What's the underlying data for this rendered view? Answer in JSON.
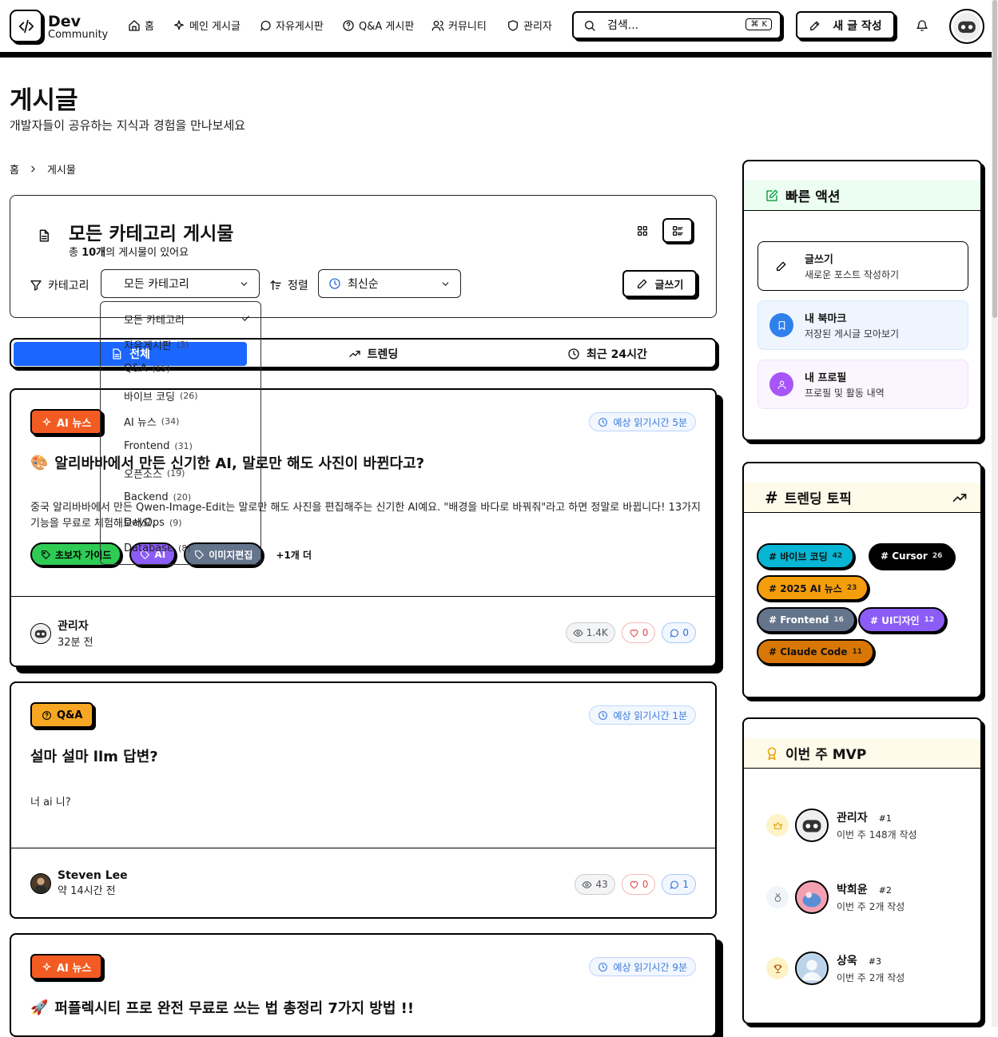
{
  "header": {
    "logo_title": "Dev",
    "logo_sub": "Community",
    "nav": [
      {
        "label": "홈",
        "icon": "home-icon"
      },
      {
        "label": "메인 게시글",
        "icon": "sparkles-icon"
      },
      {
        "label": "자유게시판",
        "icon": "chat-bubble-icon"
      },
      {
        "label": "Q&A 게시판",
        "icon": "help-circle-icon"
      },
      {
        "label": "커뮤니티",
        "icon": "users-icon"
      },
      {
        "label": "관리자",
        "icon": "shield-icon"
      }
    ],
    "search_placeholder": "검색...",
    "search_shortcut": "K",
    "new_post": "새 글 작성"
  },
  "page": {
    "title": "게시글",
    "subtitle": "개발자들이 공유하는 지식과 경험을 만나보세요",
    "breadcrumb": [
      "홈",
      "게시물"
    ]
  },
  "filter": {
    "title": "모든 카테고리 게시물",
    "count_prefix": "총 ",
    "count_value": "10개",
    "count_suffix": "의 게시물이 있어요",
    "category_label": "카테고리",
    "category_value": "모든 카테고리",
    "sort_label": "정렬",
    "sort_value": "최신순",
    "write_label": "글쓰기"
  },
  "dropdown": [
    {
      "label": "모든 카테고리",
      "count": "",
      "selected": true
    },
    {
      "label": "자유게시판",
      "count": "(3)"
    },
    {
      "label": "Q&A",
      "count": "(15)"
    },
    {
      "label": "바이브 코딩",
      "count": "(26)"
    },
    {
      "label": "AI 뉴스",
      "count": "(34)"
    },
    {
      "label": "Frontend",
      "count": "(31)"
    },
    {
      "label": "오픈소스",
      "count": "(19)"
    },
    {
      "label": "Backend",
      "count": "(20)"
    },
    {
      "label": "DevOps",
      "count": "(9)"
    },
    {
      "label": "Database",
      "count": "(8)"
    }
  ],
  "tabs": [
    "전체",
    "트렌딩",
    "최근 24시간"
  ],
  "posts": [
    {
      "badge": "AI 뉴스",
      "read_time": "예상 읽기시간 5분",
      "emoji": "🎨",
      "title": "알리바바에서 만든 신기한 AI, 말로만 해도 사진이 바뀐다고?",
      "excerpt": "중국 알리바바에서 만든 Qwen-Image-Edit는 말로만 해도 사진을 편집해주는 신기한 AI예요. \"배경을 바다로 바꿔줘\"라고 하면 정말로 바뀝니다! 13가지 기능을 무료로 체험해보세요.",
      "tags": [
        "초보자 가이드",
        "AI",
        "이미지편집"
      ],
      "more": "+1개 더",
      "author": "관리자",
      "time": "32분 전",
      "views": "1.4K",
      "likes": "0",
      "comments": "0"
    },
    {
      "badge": "Q&A",
      "read_time": "예상 읽기시간 1분",
      "title": "설마 설마 llm 답변?",
      "excerpt": "너 ai 니?",
      "author": "Steven Lee",
      "time": "약 14시간 전",
      "views": "43",
      "likes": "0",
      "comments": "1"
    },
    {
      "badge": "AI 뉴스",
      "read_time": "예상 읽기시간 9분",
      "emoji": "🚀",
      "title": "퍼플렉시티 프로 완전 무료로 쓰는 법 총정리 7가지 방법 !!"
    }
  ],
  "quick_actions": {
    "title": "빠른 액션",
    "items": [
      {
        "title": "글쓰기",
        "desc": "새로운 포스트 작성하기"
      },
      {
        "title": "내 북마크",
        "desc": "저장된 게시글 모아보기"
      },
      {
        "title": "내 프로필",
        "desc": "프로필 및 활동 내역"
      }
    ]
  },
  "trending": {
    "title": "트렌딩 토픽",
    "topics": [
      {
        "label": "# 바이브 코딩",
        "count": "42",
        "color": "#06b6d4"
      },
      {
        "label": "# Cursor",
        "count": "26",
        "color": "#000000"
      },
      {
        "label": "# 2025 AI 뉴스",
        "count": "23",
        "color": "#f59e0b"
      },
      {
        "label": "# Frontend",
        "count": "16",
        "color": "#64748b"
      },
      {
        "label": "# UI디자인",
        "count": "12",
        "color": "#8b5cf6"
      },
      {
        "label": "# Claude Code",
        "count": "11",
        "color": "#d97706"
      }
    ]
  },
  "mvp": {
    "title": "이번 주 MVP",
    "users": [
      {
        "name": "관리자",
        "rank": "#1",
        "stat": "이번 주 148개 작성"
      },
      {
        "name": "박희윤",
        "rank": "#2",
        "stat": "이번 주 2개 작성"
      },
      {
        "name": "상욱",
        "rank": "#3",
        "stat": "이번 주 2개 작성"
      }
    ]
  },
  "colors": {
    "accent": "#1a66ff",
    "ai_badge": "#f25c22",
    "qa_badge": "#f5a623",
    "tag_green": "#2ecc55",
    "tag_purple": "#8b5cf6",
    "tag_slate": "#64748b"
  }
}
